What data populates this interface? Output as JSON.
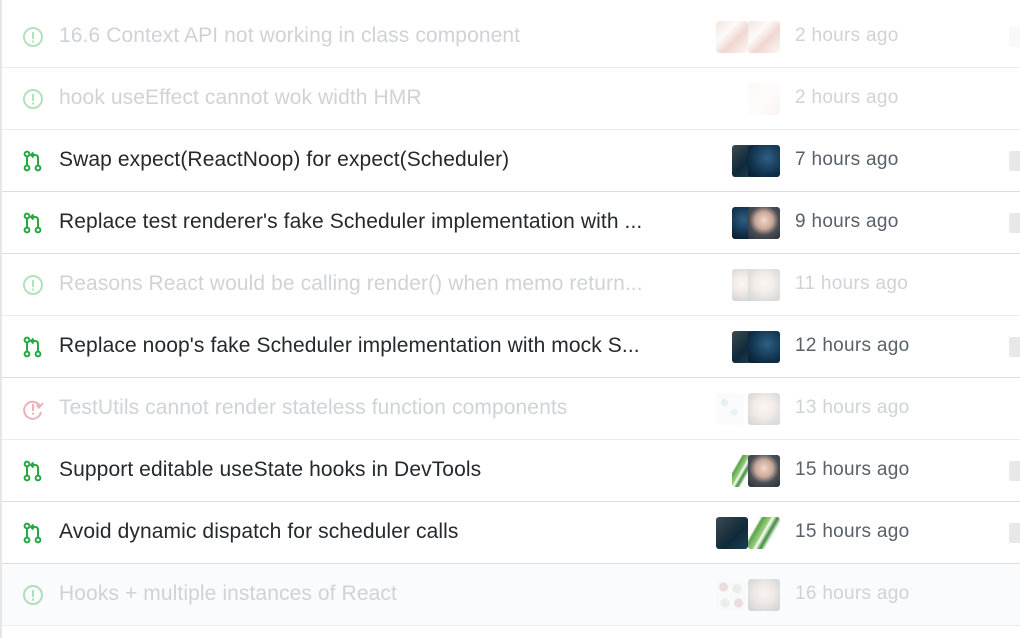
{
  "colors": {
    "open_issue": "#28a745",
    "merged_pr_open": "#28a745",
    "closed_issue": "#cb2431",
    "text_primary": "#24292e",
    "text_secondary": "#586069",
    "text_faded": "#cfd3d7"
  },
  "rows": [
    {
      "icon": "issue-opened-icon",
      "title": "16.6 Context API not working in class component",
      "time": "2 hours ago",
      "faded": true,
      "avatars": [
        "av-warm",
        "av-warm"
      ]
    },
    {
      "icon": "issue-opened-icon",
      "title": "hook useEffect cannot wok width HMR",
      "time": "2 hours ago",
      "faded": true,
      "avatars": [
        "",
        "av-pale"
      ]
    },
    {
      "icon": "pull-request-icon",
      "title": "Swap expect(ReactNoop) for expect(Scheduler)",
      "time": "7 hours ago",
      "faded": false,
      "avatars": [
        "av-dark",
        "av-blue"
      ]
    },
    {
      "icon": "pull-request-icon",
      "title": "Replace test renderer's fake Scheduler implementation with ...",
      "time": "9 hours ago",
      "faded": false,
      "avatars": [
        "av-blue",
        "av-face"
      ]
    },
    {
      "icon": "issue-opened-icon",
      "title": "Reasons React would be calling render() when memo return...",
      "time": "11 hours ago",
      "faded": true,
      "avatars": [
        "av-faceL",
        "av-faceL"
      ]
    },
    {
      "icon": "pull-request-icon",
      "title": "Replace noop's fake Scheduler implementation with mock S...",
      "time": "12 hours ago",
      "faded": false,
      "avatars": [
        "av-dark",
        "av-blue"
      ]
    },
    {
      "icon": "issue-closed-icon",
      "title": "TestUtils cannot render stateless function components",
      "time": "13 hours ago",
      "faded": true,
      "avatars": [
        "av-pix",
        "av-faceL"
      ]
    },
    {
      "icon": "pull-request-icon",
      "title": "Support editable useState hooks in DevTools",
      "time": "15 hours ago",
      "faded": false,
      "avatars": [
        "av-green",
        "av-face"
      ]
    },
    {
      "icon": "pull-request-icon",
      "title": "Avoid dynamic dispatch for scheduler calls",
      "time": "15 hours ago",
      "faded": false,
      "avatars": [
        "av-dark",
        "av-green"
      ]
    },
    {
      "icon": "issue-opened-icon",
      "title": "Hooks + multiple instances of React",
      "time": "16 hours ago",
      "faded": true,
      "avatars": [
        "av-dots",
        "av-faceL"
      ]
    }
  ]
}
